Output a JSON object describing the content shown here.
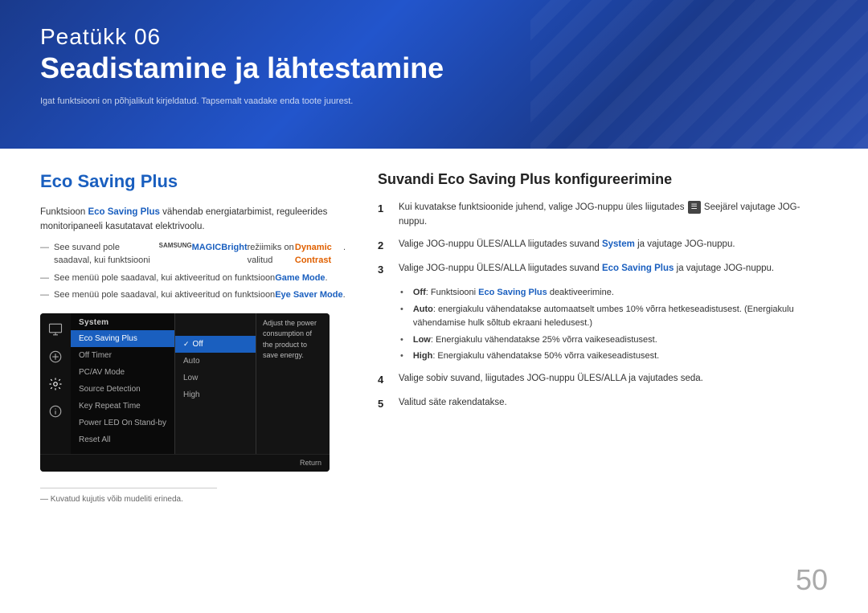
{
  "header": {
    "chapter_label": "Peatükk  06",
    "chapter_title": "Seadistamine ja lähtestamine",
    "subtitle": "Igat funktsiooni on põhjalikult kirjeldatud. Tapsemalt vaadake enda toote juurest."
  },
  "left": {
    "section_title": "Eco Saving Plus",
    "intro": "Funktsioon ",
    "intro_highlight": "Eco Saving Plus",
    "intro_rest": " vähendab energiatarbimist, reguleerides monitoripaneeli kasutatavat elektrivoolu.",
    "note1_pre": "See suvand pole saadaval, kui funktsiooni ",
    "note1_magic": "MAGIC",
    "note1_bright": "Bright",
    "note1_rest": " režiimiks on valitud ",
    "note1_link": "Dynamic Contrast",
    "note2_pre": "See menüü pole saadaval, kui aktiveeritud on funktsioon ",
    "note2_link": "Game Mode",
    "note3_pre": "See menüü pole saadaval, kui aktiveeritud on funktsioon ",
    "note3_link": "Eye Saver Mode",
    "image_note": "Kuvatud kujutis võib mudeliti erineda.",
    "osd": {
      "menu_title": "System",
      "items": [
        {
          "label": "Eco Saving Plus",
          "active": true
        },
        {
          "label": "Off Timer",
          "active": false
        },
        {
          "label": "PC/AV Mode",
          "active": false
        },
        {
          "label": "Source Detection",
          "active": false
        },
        {
          "label": "Key Repeat Time",
          "active": false
        },
        {
          "label": "Power LED On",
          "active": false
        },
        {
          "label": "Reset All",
          "active": false
        }
      ],
      "sub_items": [
        {
          "label": "Off",
          "active": true
        },
        {
          "label": "Auto",
          "active": false
        },
        {
          "label": "Low",
          "active": false
        },
        {
          "label": "High",
          "active": false
        }
      ],
      "right_text": "Adjust the power consumption of the product to save energy.",
      "power_led_value": "Stand-by",
      "return_label": "Return"
    }
  },
  "right": {
    "title": "Suvandi Eco Saving Plus konfigureerimine",
    "steps": [
      {
        "num": "1",
        "text_pre": "Kui kuvatakse funktsioonide juhend, valige JOG-nuppu üles liigutades ",
        "text_kbd": "☰",
        "text_post": " Seejärel vajutage JOG-nuppu."
      },
      {
        "num": "2",
        "text_pre": "Valige JOG-nuppu ÜLES/ALLA liigutades suvand ",
        "text_highlight": "System",
        "text_post": " ja vajutage JOG-nuppu."
      },
      {
        "num": "3",
        "text_pre": "Valige JOG-nuppu ÜLES/ALLA liigutades suvand ",
        "text_highlight": "Eco Saving Plus",
        "text_post": " ja vajutage JOG-nuppu."
      }
    ],
    "bullets": [
      {
        "pre": "Off",
        "pre_bold": true,
        "text": ": Funktsiooni ",
        "highlight": "Eco Saving Plus",
        "post": " deaktiveerimine."
      },
      {
        "pre": "Auto",
        "pre_bold": true,
        "text": ": energiakulu vähendatakse automaatselt umbes 10% võrra hetkeseadistusest. (Energiakulu vähendamise hulk sõltub ekraani heledusest.)",
        "highlight": "",
        "post": ""
      },
      {
        "pre": "Low",
        "pre_bold": true,
        "text": ": Energiakulu vähendatakse 25% võrra vaikeseadistusest.",
        "highlight": "",
        "post": ""
      },
      {
        "pre": "High",
        "pre_bold": true,
        "text": ": Energiakulu vähendatakse 50% võrra vaikeseadistusest.",
        "highlight": "",
        "post": ""
      }
    ],
    "step4": "4",
    "step4_text": "Valige sobiv suvand, liigutades JOG-nuppu ÜLES/ALLA ja vajutades seda.",
    "step5": "5",
    "step5_text": "Valitud säte rakendatakse.",
    "page_number": "50"
  }
}
